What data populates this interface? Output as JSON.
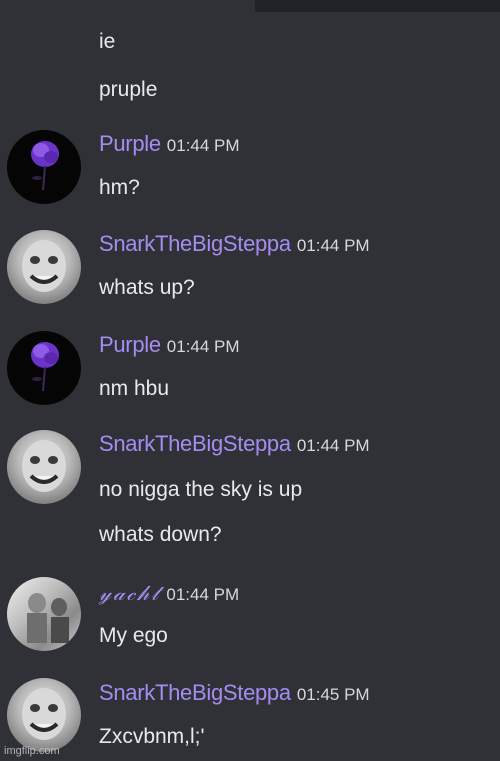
{
  "messages": {
    "cont1": "ie",
    "cont2": "pruple",
    "m1": {
      "author": "Purple",
      "time": "01:44 PM",
      "text": "hm?"
    },
    "m2": {
      "author": "SnarkTheBigSteppa",
      "time": "01:44 PM",
      "text": "whats up?"
    },
    "m3": {
      "author": "Purple",
      "time": "01:44 PM",
      "text": "nm hbu"
    },
    "m4": {
      "author": "SnarkTheBigSteppa",
      "time": "01:44 PM",
      "text1": "no nigga the sky is up",
      "text2": "whats down?"
    },
    "m5": {
      "author": "𝓎𝒶𝒸𝒽𝓉",
      "time": "01:44 PM",
      "text": "My ego"
    },
    "m6": {
      "author": "SnarkTheBigSteppa",
      "time": "01:45 PM",
      "text": "Zxcvbnm,l;'"
    }
  },
  "watermark": "imgflip.com",
  "colors": {
    "background": "#2f3136",
    "author": "#a58cf0",
    "text": "#e8e9ea",
    "timestamp": "#d7d8da"
  }
}
